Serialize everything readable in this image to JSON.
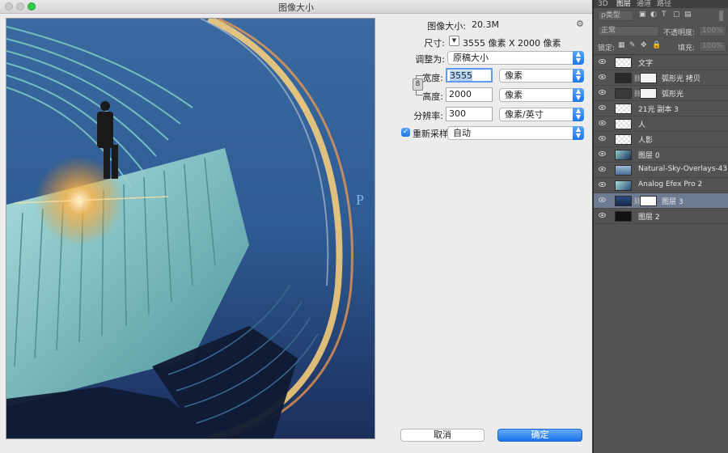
{
  "dialog": {
    "title": "图像大小",
    "image_size_label": "图像大小:",
    "image_size_value": "20.3M",
    "dimensions_label": "尺寸:",
    "dimensions_value": "3555 像素  X  2000 像素",
    "fit_to_label": "调整为:",
    "fit_to_value": "原稿大小",
    "width_label": "宽度:",
    "width_value": "3555",
    "width_unit": "像素",
    "height_label": "高度:",
    "height_value": "2000",
    "height_unit": "像素",
    "resolution_label": "分辨率:",
    "resolution_value": "300",
    "resolution_unit": "像素/英寸",
    "resample_label": "重新采样:",
    "resample_value": "自动",
    "cancel_label": "取消",
    "ok_label": "确定",
    "preview_letter": "P"
  },
  "panel": {
    "tabs": [
      "3D",
      "图层",
      "通道",
      "路径"
    ],
    "filter_kind": "ρ类型",
    "blend_mode": "正常",
    "opacity_label": "不透明度:",
    "opacity_value": "100%",
    "lock_label": "锁定:",
    "fill_label": "填充:",
    "fill_value": "100%",
    "layers": [
      {
        "name": "文字"
      },
      {
        "name": "弧形光 拷贝"
      },
      {
        "name": "弧形光"
      },
      {
        "name": "21光 副本 3"
      },
      {
        "name": "人"
      },
      {
        "name": "人影"
      },
      {
        "name": "图层 0"
      },
      {
        "name": "Natural-Sky-Overlays-43"
      },
      {
        "name": "Analog Efex Pro 2"
      },
      {
        "name": "图层 3"
      },
      {
        "name": "图层 2"
      }
    ]
  },
  "colors": {
    "accent": "#1f74e8",
    "panel_bg": "#535353",
    "active_layer": "#6c7a92",
    "sky": "#274a7a",
    "stair_teal": "#8fd3cf"
  }
}
